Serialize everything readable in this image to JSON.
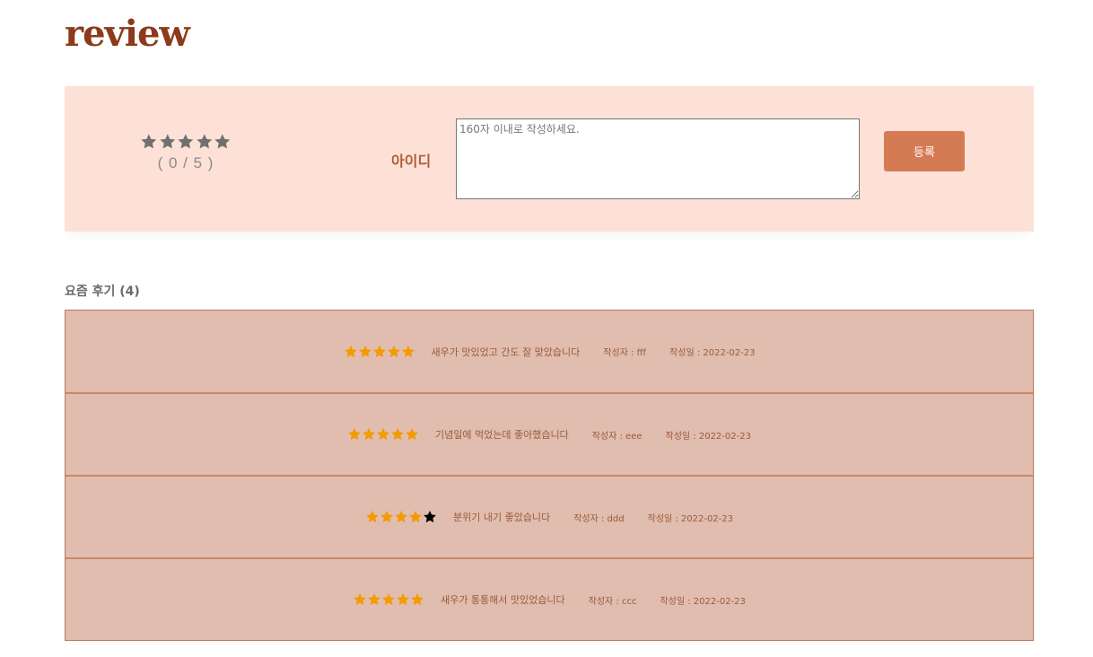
{
  "logo": "review",
  "form": {
    "rating_display": "( 0 / 5 )",
    "rating_value": 0,
    "rating_max": 5,
    "user_label": "아이디",
    "textarea_placeholder": "160자 이내로 작성하세요.",
    "submit_label": "등록"
  },
  "list": {
    "title": "요즘 후기 (4)",
    "reviews": [
      {
        "rating": 5,
        "text": "새우가 맛있었고 간도 잘 맞았습니다",
        "writer": "작성자 : fff",
        "date": "작성일 : 2022-02-23"
      },
      {
        "rating": 5,
        "text": "기념일에 먹었는데 좋아했습니다",
        "writer": "작성자 : eee",
        "date": "작성일 : 2022-02-23"
      },
      {
        "rating": 4,
        "text": "분위기 내기 좋았습니다",
        "writer": "작성자 : ddd",
        "date": "작성일 : 2022-02-23"
      },
      {
        "rating": 5,
        "text": "새우가 통통해서 맛있었습니다",
        "writer": "작성자 : ccc",
        "date": "작성일 : 2022-02-23"
      }
    ]
  },
  "colors": {
    "star_empty_form": "#707070",
    "star_filled": "#f59a00",
    "star_empty_list": "#000000"
  }
}
